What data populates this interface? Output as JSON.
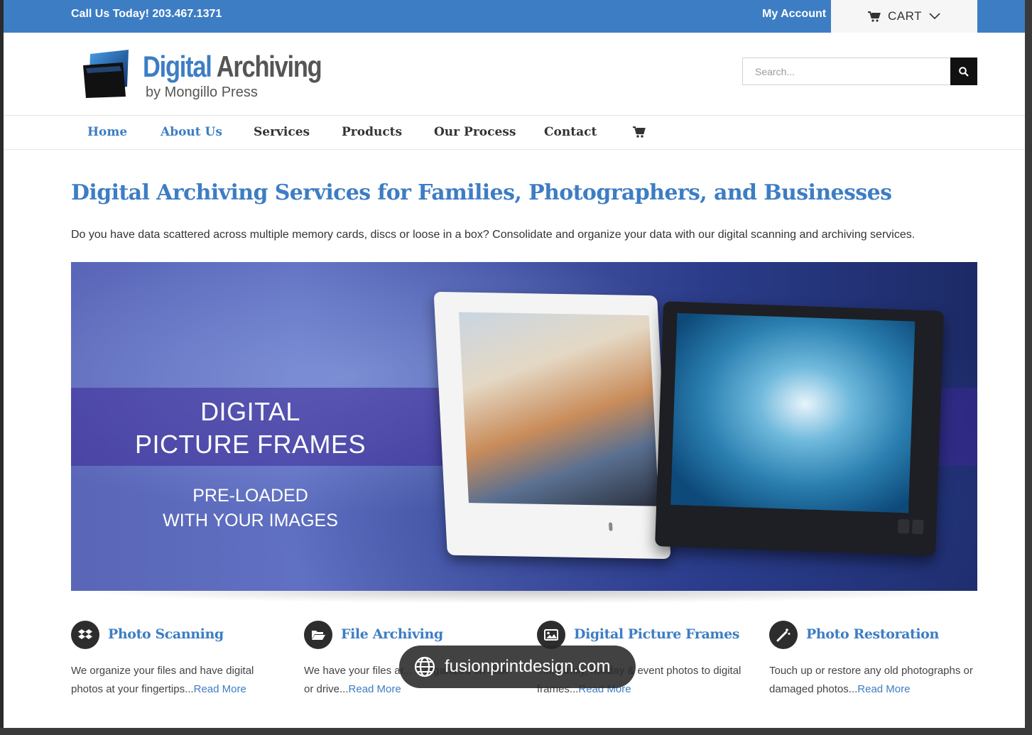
{
  "topbar": {
    "phone": "Call Us Today! 203.467.1371",
    "account": "My Account",
    "cart_label": "CART"
  },
  "logo": {
    "word1": "Digital",
    "word2": "Archiving",
    "subtitle": "by Mongillo Press"
  },
  "search": {
    "placeholder": "Search..."
  },
  "nav": {
    "items": [
      {
        "label": "Home"
      },
      {
        "label": "About Us"
      },
      {
        "label": "Services"
      },
      {
        "label": "Products"
      },
      {
        "label": "Our Process"
      },
      {
        "label": "Contact"
      }
    ]
  },
  "main": {
    "headline": "Digital Archiving Services for Families, Photographers, and Businesses",
    "intro": "Do you have data scattered across multiple memory cards, discs or loose in a box? Consolidate and organize your data with our digital scanning and archiving services."
  },
  "banner": {
    "line1": "DIGITAL",
    "line2": "PICTURE FRAMES",
    "line3": "PRE-LOADED",
    "line4": "WITH YOUR IMAGES"
  },
  "features": [
    {
      "title": "Photo Scanning",
      "text": "We organize your files and have digital photos at your fingertips...",
      "link": "Read More"
    },
    {
      "title": "File Archiving",
      "text": "We have your files ar... d organized on disk or drive...",
      "link": "Read More"
    },
    {
      "title": "Digital Picture Frames",
      "text": "...n, family, holiday & event photos to digital frames...",
      "link": "Read More"
    },
    {
      "title": "Photo Restoration",
      "text": "Touch up or restore any old photographs or damaged photos...",
      "link": "Read More"
    }
  ],
  "watermark": {
    "text": "fusionprintdesign.com"
  },
  "colors": {
    "brand_blue": "#3d7dc4",
    "dark": "#2d2d2d"
  }
}
